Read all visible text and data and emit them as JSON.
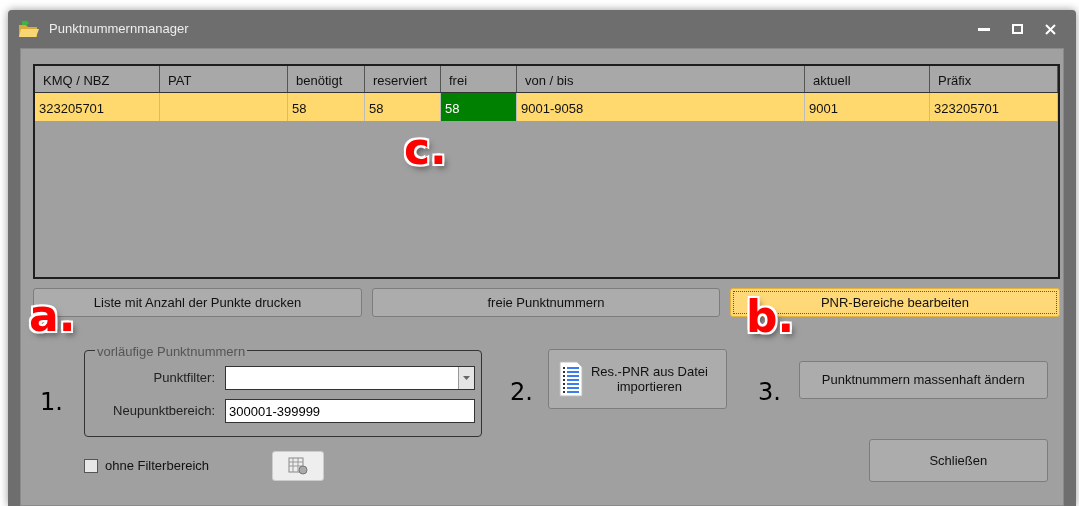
{
  "window": {
    "title": "Punktnummernmanager"
  },
  "table": {
    "columns": [
      "KMQ / NBZ",
      "PAT",
      "benötigt",
      "reserviert",
      "frei",
      "von / bis",
      "aktuell",
      "Präfix"
    ],
    "rows": [
      {
        "selected": true,
        "cells": [
          {
            "text": "323205701"
          },
          {
            "text": ""
          },
          {
            "text": "58"
          },
          {
            "text": "58"
          },
          {
            "text": "58",
            "color": "#008000"
          },
          {
            "text": "9001-9058"
          },
          {
            "text": "9001"
          },
          {
            "text": "323205701"
          }
        ]
      }
    ]
  },
  "action_buttons": [
    {
      "label": "Liste mit Anzahl der Punkte drucken",
      "focused": false
    },
    {
      "label": "freie Punktnummern",
      "focused": false
    },
    {
      "label": "PNR-Bereiche bearbeiten",
      "focused": true
    }
  ],
  "steps": [
    {
      "number": "1."
    },
    {
      "number": "2."
    },
    {
      "number": "3."
    }
  ],
  "group": {
    "title": "vorläufige Punktnummern",
    "filter_label": "Punktfilter:",
    "range_label": "Neupunktbereich:",
    "range_value": "300001-399999"
  },
  "import_button": {
    "label": "Res.-PNR aus Datei importieren"
  },
  "mass_change_button": {
    "label": "Punktnummern massenhaft ändern"
  },
  "no_filter_checkbox": {
    "label": "ohne Filterbereich",
    "checked": false
  },
  "close_button": {
    "label": "Schließen"
  },
  "annotations": [
    {
      "label": "a."
    },
    {
      "label": "b."
    },
    {
      "label": "c."
    }
  ]
}
